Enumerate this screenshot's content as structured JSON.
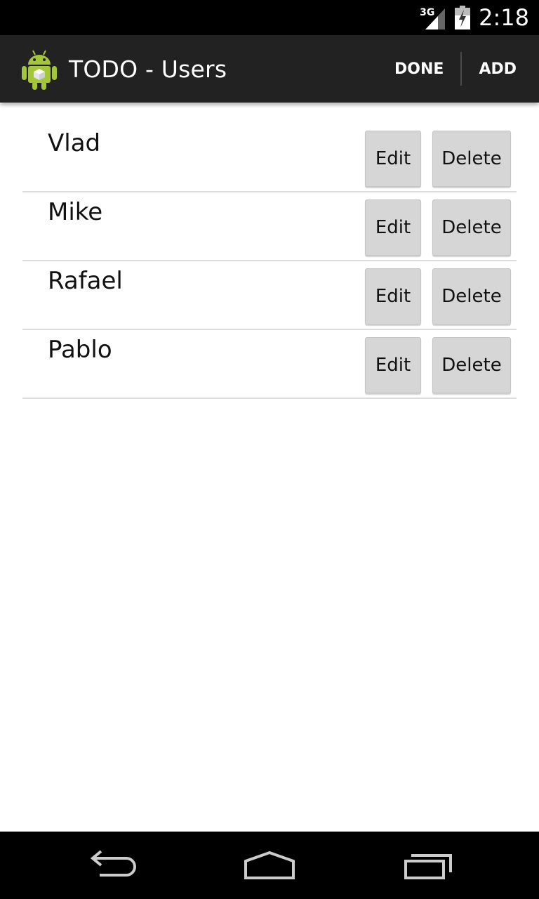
{
  "status_bar": {
    "network_label": "3G",
    "time": "2:18",
    "signal_icon": "signal-icon",
    "battery_icon": "battery-charging-icon"
  },
  "action_bar": {
    "app_icon": "android-icon",
    "title": "TODO - Users",
    "done_label": "DONE",
    "add_label": "ADD"
  },
  "users": [
    {
      "name": "Vlad",
      "edit_label": "Edit",
      "delete_label": "Delete"
    },
    {
      "name": "Mike",
      "edit_label": "Edit",
      "delete_label": "Delete"
    },
    {
      "name": "Rafael",
      "edit_label": "Edit",
      "delete_label": "Delete"
    },
    {
      "name": "Pablo",
      "edit_label": "Edit",
      "delete_label": "Delete"
    }
  ],
  "nav_bar": {
    "back_icon": "back-icon",
    "home_icon": "home-icon",
    "recents_icon": "recents-icon"
  },
  "colors": {
    "action_bar_bg": "#222222",
    "status_bar_bg": "#000000",
    "button_bg": "#d6d6d6",
    "android_green": "#a4c639"
  }
}
